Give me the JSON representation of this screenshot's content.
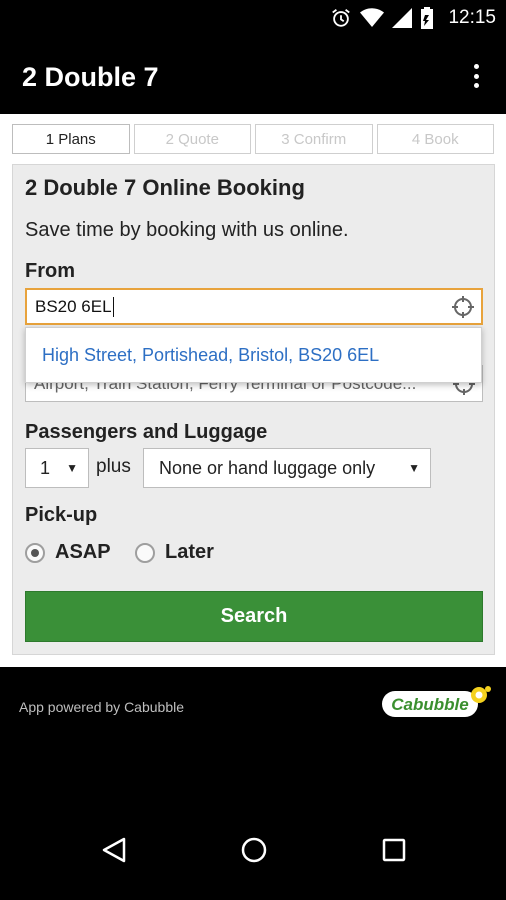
{
  "status_bar": {
    "time": "12:15",
    "icons": [
      "alarm-icon",
      "wifi-icon",
      "signal-icon",
      "battery-icon"
    ]
  },
  "app_bar": {
    "title": "2 Double 7",
    "menu_icon": "overflow-menu-icon"
  },
  "steps": [
    {
      "label": "1 Plans",
      "active": true
    },
    {
      "label": "2 Quote",
      "active": false
    },
    {
      "label": "3 Confirm",
      "active": false
    },
    {
      "label": "4 Book",
      "active": false
    }
  ],
  "form": {
    "title": "2 Double 7 Online Booking",
    "subtitle": "Save time by booking with us online.",
    "from_label": "From",
    "from_value": "BS20 6EL",
    "suggestion": "High Street, Portishead, Bristol, BS20 6EL",
    "to_placeholder": "Airport, Train Station, Ferry Terminal or Postcode...",
    "passengers_label": "Passengers and Luggage",
    "passengers_value": "1",
    "plus_text": "plus",
    "luggage_value": "None or hand luggage only",
    "pickup_label": "Pick-up",
    "pickup_options": [
      {
        "label": "ASAP",
        "checked": true
      },
      {
        "label": "Later",
        "checked": false
      }
    ],
    "search_label": "Search"
  },
  "footer": {
    "powered_by": "App powered by Cabubble",
    "logo_text": "Cabubble"
  },
  "colors": {
    "accent_green": "#3a9038",
    "link_blue": "#2d6fc4",
    "focus_orange": "#e8a33c"
  }
}
